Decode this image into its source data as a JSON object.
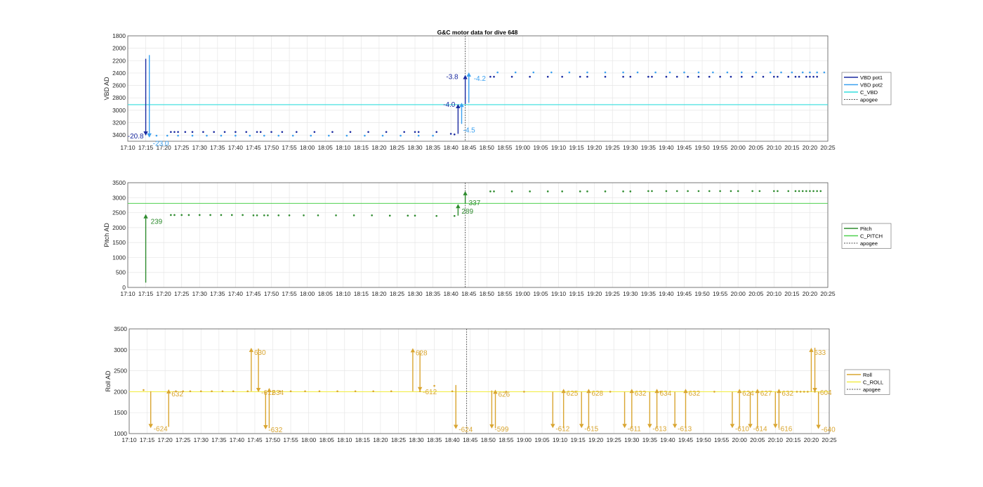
{
  "figure_title": "G&C motor data for dive 648",
  "colors": {
    "vbd_pot1": "#1a2aa0",
    "vbd_pot2": "#3aa0f0",
    "c_vbd": "#33dede",
    "pitch": "#2e8b2e",
    "c_pitch": "#4fd14f",
    "roll": "#d9a530",
    "c_roll": "#f2ee4a",
    "apogee": "#555555",
    "grid": "#e6e6e6"
  },
  "x_ticks": [
    "17:10",
    "17:15",
    "17:20",
    "17:25",
    "17:30",
    "17:35",
    "17:40",
    "17:45",
    "17:50",
    "17:55",
    "18:00",
    "18:05",
    "18:10",
    "18:15",
    "18:20",
    "18:25",
    "18:30",
    "18:35",
    "18:40",
    "18:45",
    "18:50",
    "18:55",
    "19:00",
    "19:05",
    "19:10",
    "19:15",
    "19:20",
    "19:25",
    "19:30",
    "19:35",
    "19:40",
    "19:45",
    "19:50",
    "19:55",
    "20:00",
    "20:05",
    "20:10",
    "20:15",
    "20:20",
    "20:25"
  ],
  "chart_data": [
    {
      "type": "scatter",
      "title": "G&C motor data for dive 648",
      "ylabel": "VBD AD",
      "y_reversed": true,
      "xlim": [
        "17:10",
        "20:25"
      ],
      "ylim": [
        3500,
        1800
      ],
      "yticks": [
        1800,
        2000,
        2200,
        2400,
        2600,
        2800,
        3000,
        3200,
        3400
      ],
      "grid": true,
      "legend_position": "right",
      "legend": [
        "VBD pot1",
        "VBD pot2",
        "C_VBD",
        "apogee"
      ],
      "apogee_time": "18:44",
      "reference_lines": [
        {
          "name": "C_VBD",
          "y": 2910
        }
      ],
      "series": [
        {
          "name": "VBD pot1",
          "x": [
            "17:22",
            "17:23",
            "17:24",
            "17:26",
            "17:28",
            "17:31",
            "17:34",
            "17:37",
            "17:40",
            "17:43",
            "17:46",
            "17:47",
            "17:50",
            "17:53",
            "17:57",
            "18:02",
            "18:07",
            "18:12",
            "18:17",
            "18:22",
            "18:27",
            "18:30",
            "18:31",
            "18:36",
            "18:40",
            "18:41",
            "18:51",
            "18:52",
            "18:57",
            "19:02",
            "19:07",
            "19:11",
            "19:16",
            "19:18",
            "19:23",
            "19:28",
            "19:30",
            "19:35",
            "19:36",
            "19:40",
            "19:43",
            "19:46",
            "19:49",
            "19:52",
            "19:55",
            "19:58",
            "20:01",
            "20:04",
            "20:07",
            "20:10",
            "20:11",
            "20:14",
            "20:16",
            "20:17",
            "20:19",
            "20:20",
            "20:21",
            "20:22"
          ],
          "y": [
            3350,
            3350,
            3350,
            3350,
            3350,
            3350,
            3350,
            3350,
            3350,
            3350,
            3350,
            3350,
            3350,
            3350,
            3350,
            3350,
            3350,
            3350,
            3350,
            3350,
            3350,
            3350,
            3350,
            3350,
            3380,
            3390,
            2460,
            2460,
            2460,
            2460,
            2460,
            2460,
            2460,
            2460,
            2460,
            2460,
            2460,
            2460,
            2460,
            2460,
            2460,
            2460,
            2460,
            2460,
            2460,
            2460,
            2460,
            2460,
            2460,
            2460,
            2460,
            2460,
            2460,
            2460,
            2460,
            2460,
            2460,
            2460
          ]
        },
        {
          "name": "VBD pot2",
          "x": [
            "17:16",
            "17:18",
            "17:21",
            "17:24",
            "17:28",
            "17:32",
            "17:36",
            "17:40",
            "17:44",
            "17:48",
            "17:52",
            "17:56",
            "18:01",
            "18:06",
            "18:11",
            "18:16",
            "18:21",
            "18:26",
            "18:31",
            "18:35",
            "18:53",
            "18:58",
            "19:03",
            "19:08",
            "19:13",
            "19:18",
            "19:23",
            "19:28",
            "19:32",
            "19:37",
            "19:41",
            "19:45",
            "19:49",
            "19:53",
            "19:57",
            "20:01",
            "20:05",
            "20:09",
            "20:12",
            "20:15",
            "20:18",
            "20:20",
            "20:22",
            "20:24"
          ],
          "y": [
            3410,
            3410,
            3410,
            3410,
            3410,
            3410,
            3410,
            3410,
            3410,
            3410,
            3410,
            3410,
            3410,
            3410,
            3410,
            3410,
            3410,
            3410,
            3410,
            3410,
            2390,
            2390,
            2390,
            2390,
            2390,
            2390,
            2390,
            2390,
            2390,
            2390,
            2390,
            2390,
            2390,
            2390,
            2390,
            2390,
            2390,
            2390,
            2390,
            2390,
            2390,
            2390,
            2390,
            2390
          ]
        }
      ],
      "moves": [
        {
          "series": "VBD pot1",
          "x": "17:15",
          "from": 2170,
          "to": 3410,
          "label": "-20.8"
        },
        {
          "series": "VBD pot2",
          "x": "17:16",
          "from": 2110,
          "to": 3440,
          "label": "-23.0"
        },
        {
          "series": "VBD pot1",
          "x": "18:42",
          "from": 3380,
          "to": 2900,
          "label": "-4.0"
        },
        {
          "series": "VBD pot2",
          "x": "18:43",
          "from": 3220,
          "to": 2880,
          "label": "-4.5"
        },
        {
          "series": "VBD pot1",
          "x": "18:44",
          "from": 2900,
          "to": 2430,
          "label": "-3.8"
        },
        {
          "series": "VBD pot2",
          "x": "18:45",
          "from": 2880,
          "to": 2390,
          "label": "-4.2"
        }
      ]
    },
    {
      "type": "scatter",
      "ylabel": "Pitch AD",
      "xlim": [
        "17:10",
        "20:25"
      ],
      "ylim": [
        0,
        3500
      ],
      "yticks": [
        0,
        500,
        1000,
        1500,
        2000,
        2500,
        3000,
        3500
      ],
      "grid": true,
      "legend_position": "right",
      "legend": [
        "Pitch",
        "C_PITCH",
        "apogee"
      ],
      "apogee_time": "18:44",
      "reference_lines": [
        {
          "name": "C_PITCH",
          "y": 2810
        }
      ],
      "series": [
        {
          "name": "Pitch",
          "x": [
            "17:22",
            "17:23",
            "17:25",
            "17:27",
            "17:30",
            "17:33",
            "17:36",
            "17:39",
            "17:42",
            "17:45",
            "17:46",
            "17:48",
            "17:49",
            "17:52",
            "17:55",
            "17:59",
            "18:03",
            "18:08",
            "18:13",
            "18:18",
            "18:23",
            "18:28",
            "18:30",
            "18:36",
            "18:41",
            "18:51",
            "18:52",
            "18:57",
            "19:02",
            "19:07",
            "19:11",
            "19:16",
            "19:18",
            "19:23",
            "19:28",
            "19:30",
            "19:35",
            "19:36",
            "19:40",
            "19:43",
            "19:46",
            "19:49",
            "19:52",
            "19:55",
            "19:58",
            "20:00",
            "20:04",
            "20:06",
            "20:10",
            "20:11",
            "20:14",
            "20:16",
            "20:17",
            "20:18",
            "20:19",
            "20:20",
            "20:21",
            "20:22",
            "20:23"
          ],
          "y": [
            2420,
            2420,
            2420,
            2420,
            2420,
            2420,
            2420,
            2420,
            2420,
            2410,
            2410,
            2410,
            2410,
            2410,
            2410,
            2410,
            2410,
            2410,
            2410,
            2410,
            2400,
            2400,
            2400,
            2390,
            2390,
            3210,
            3210,
            3210,
            3210,
            3210,
            3210,
            3210,
            3210,
            3210,
            3210,
            3210,
            3220,
            3220,
            3220,
            3220,
            3220,
            3220,
            3220,
            3220,
            3220,
            3220,
            3220,
            3220,
            3220,
            3220,
            3220,
            3220,
            3220,
            3220,
            3220,
            3220,
            3220,
            3220,
            3220
          ]
        }
      ],
      "moves": [
        {
          "series": "Pitch",
          "x": "17:15",
          "from": 160,
          "to": 2450,
          "label": "239"
        },
        {
          "series": "Pitch",
          "x": "18:42",
          "from": 2400,
          "to": 2790,
          "label": "289"
        },
        {
          "series": "Pitch",
          "x": "18:44",
          "from": 2790,
          "to": 3220,
          "label": "337"
        }
      ]
    },
    {
      "type": "scatter",
      "ylabel": "Roll AD",
      "xlim": [
        "17:10",
        "20:25"
      ],
      "ylim": [
        1000,
        3500
      ],
      "yticks": [
        1000,
        1500,
        2000,
        2500,
        3000,
        3500
      ],
      "grid": true,
      "legend_position": "right",
      "legend": [
        "Roll",
        "C_ROLL",
        "apogee"
      ],
      "apogee_time": "18:44",
      "reference_lines": [
        {
          "name": "C_ROLL",
          "y": 2000
        }
      ],
      "series": [
        {
          "name": "Roll",
          "x": [
            "17:14",
            "17:23",
            "17:25",
            "17:27",
            "17:30",
            "17:33",
            "17:36",
            "17:39",
            "17:43",
            "17:52",
            "17:55",
            "17:59",
            "18:03",
            "18:08",
            "18:13",
            "18:18",
            "18:23",
            "18:31",
            "18:35",
            "18:40",
            "18:55",
            "19:00",
            "19:24",
            "19:38",
            "19:53",
            "20:16",
            "20:17",
            "20:18",
            "20:19",
            "20:21"
          ],
          "y": [
            2040,
            2010,
            2010,
            2010,
            2010,
            2010,
            2010,
            2010,
            2010,
            2010,
            2010,
            2010,
            2010,
            2010,
            2010,
            2010,
            2010,
            2010,
            2140,
            2010,
            2000,
            2000,
            2000,
            2000,
            2000,
            2000,
            2000,
            2000,
            2000,
            2000
          ]
        }
      ],
      "moves": [
        {
          "series": "Roll",
          "x": "17:16",
          "from": 2010,
          "to": 1130,
          "label": "-624"
        },
        {
          "series": "Roll",
          "x": "17:21",
          "from": 1160,
          "to": 2060,
          "label": "632"
        },
        {
          "series": "Roll",
          "x": "17:44",
          "from": 2010,
          "to": 3050,
          "label": "630"
        },
        {
          "series": "Roll",
          "x": "17:46",
          "from": 3030,
          "to": 1990,
          "label": "-612"
        },
        {
          "series": "Roll",
          "x": "17:48",
          "from": 2010,
          "to": 1100,
          "label": "-632"
        },
        {
          "series": "Roll",
          "x": "17:49",
          "from": 1130,
          "to": 2090,
          "label": "634"
        },
        {
          "series": "Roll",
          "x": "18:29",
          "from": 2010,
          "to": 3040,
          "label": "628"
        },
        {
          "series": "Roll",
          "x": "18:31",
          "from": 2980,
          "to": 2010,
          "label": "-612"
        },
        {
          "series": "Roll",
          "x": "18:41",
          "from": 2160,
          "to": 1110,
          "label": "-624"
        },
        {
          "series": "Roll",
          "x": "18:51",
          "from": 2030,
          "to": 1120,
          "label": "-599"
        },
        {
          "series": "Roll",
          "x": "18:52",
          "from": 1130,
          "to": 2050,
          "label": "626"
        },
        {
          "series": "Roll",
          "x": "19:08",
          "from": 2000,
          "to": 1130,
          "label": "-612"
        },
        {
          "series": "Roll",
          "x": "19:11",
          "from": 1130,
          "to": 2070,
          "label": "625"
        },
        {
          "series": "Roll",
          "x": "19:16",
          "from": 2000,
          "to": 1130,
          "label": "-615"
        },
        {
          "series": "Roll",
          "x": "19:18",
          "from": 1130,
          "to": 2070,
          "label": "628"
        },
        {
          "series": "Roll",
          "x": "19:28",
          "from": 2000,
          "to": 1130,
          "label": "-611"
        },
        {
          "series": "Roll",
          "x": "19:30",
          "from": 1130,
          "to": 2070,
          "label": "632"
        },
        {
          "series": "Roll",
          "x": "19:35",
          "from": 2000,
          "to": 1130,
          "label": "-613"
        },
        {
          "series": "Roll",
          "x": "19:37",
          "from": 1130,
          "to": 2070,
          "label": "634"
        },
        {
          "series": "Roll",
          "x": "19:42",
          "from": 2000,
          "to": 1130,
          "label": "-613"
        },
        {
          "series": "Roll",
          "x": "19:45",
          "from": 1130,
          "to": 2070,
          "label": "632"
        },
        {
          "series": "Roll",
          "x": "19:58",
          "from": 2000,
          "to": 1130,
          "label": "-610"
        },
        {
          "series": "Roll",
          "x": "20:00",
          "from": 1130,
          "to": 2070,
          "label": "624"
        },
        {
          "series": "Roll",
          "x": "20:03",
          "from": 2000,
          "to": 1130,
          "label": "-614"
        },
        {
          "series": "Roll",
          "x": "20:05",
          "from": 1130,
          "to": 2070,
          "label": "627"
        },
        {
          "series": "Roll",
          "x": "20:10",
          "from": 2000,
          "to": 1130,
          "label": "-616"
        },
        {
          "series": "Roll",
          "x": "20:11",
          "from": 1130,
          "to": 2070,
          "label": "632"
        },
        {
          "series": "Roll",
          "x": "20:20",
          "from": 2000,
          "to": 3050,
          "label": "633"
        },
        {
          "series": "Roll",
          "x": "20:21",
          "from": 3050,
          "to": 1990,
          "label": "-604"
        },
        {
          "series": "Roll",
          "x": "20:22",
          "from": 2000,
          "to": 1110,
          "label": "-640"
        }
      ]
    }
  ]
}
